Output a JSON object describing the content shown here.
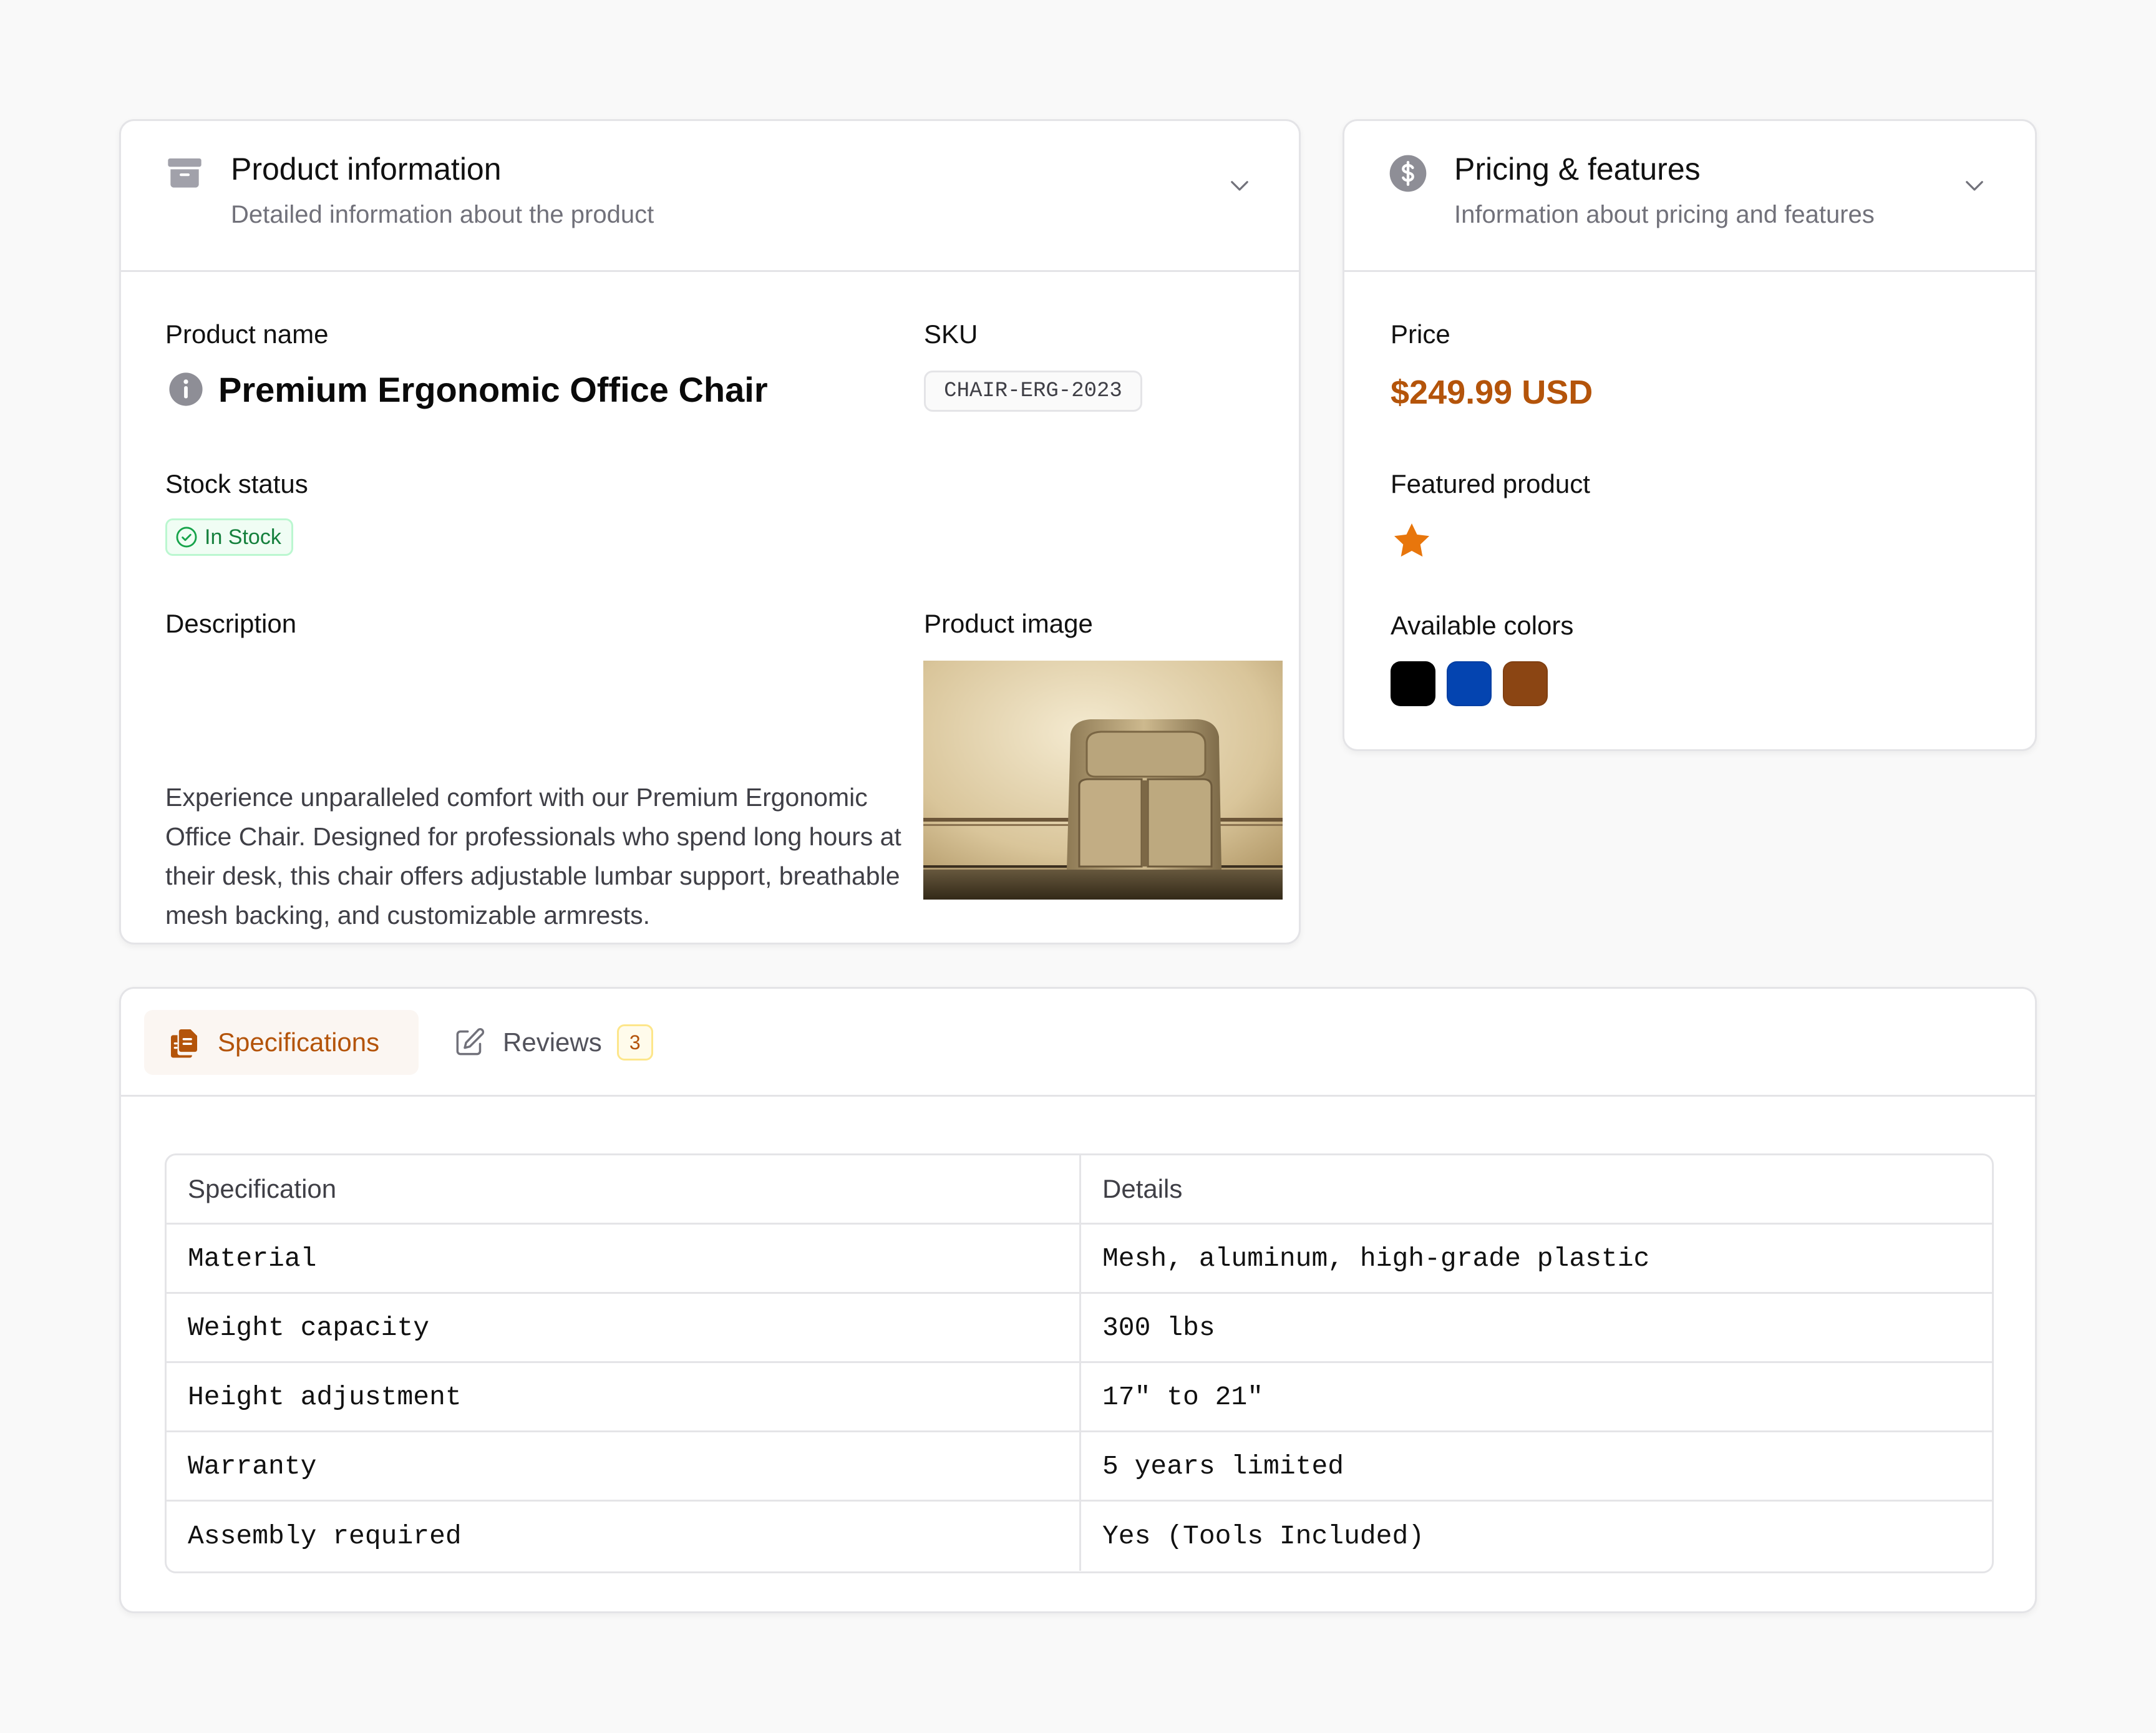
{
  "product_card": {
    "title": "Product information",
    "subtitle": "Detailed information about the product",
    "icon": "archive-box-icon",
    "product_name_label": "Product name",
    "product_name": "Premium Ergonomic Office Chair",
    "sku_label": "SKU",
    "sku": "CHAIR-ERG-2023",
    "stock_label": "Stock status",
    "stock_value": "In Stock",
    "description_label": "Description",
    "description": "Experience unparalleled comfort with our Premium Ergonomic Office Chair. Designed for professionals who spend long hours at their desk, this chair offers adjustable lumbar support, breathable mesh backing, and customizable armrests.",
    "image_label": "Product image"
  },
  "pricing_card": {
    "title": "Pricing & features",
    "subtitle": "Information about pricing and features",
    "icon": "dollar-circle-icon",
    "price_label": "Price",
    "price": "$249.99 USD",
    "featured_label": "Featured product",
    "featured_icon": "star-icon",
    "colors_label": "Available colors",
    "colors": [
      "#000000",
      "#0444b0",
      "#8b4513"
    ]
  },
  "tabs": {
    "items": [
      {
        "label": "Specifications",
        "icon": "documents-icon",
        "active": true
      },
      {
        "label": "Reviews",
        "icon": "pencil-square-icon",
        "count": "3",
        "active": false
      }
    ]
  },
  "specs": {
    "headers": [
      "Specification",
      "Details"
    ],
    "rows": [
      [
        "Material",
        "Mesh, aluminum, high-grade plastic"
      ],
      [
        "Weight capacity",
        "300 lbs"
      ],
      [
        "Height adjustment",
        "17\" to 21\""
      ],
      [
        "Warranty",
        "5 years limited"
      ],
      [
        "Assembly required",
        "Yes (Tools Included)"
      ]
    ]
  },
  "colors": {
    "accent": "#b4540a",
    "star": "#e8760c",
    "success": "#15803d",
    "icon_gray": "#a1a1aa"
  }
}
